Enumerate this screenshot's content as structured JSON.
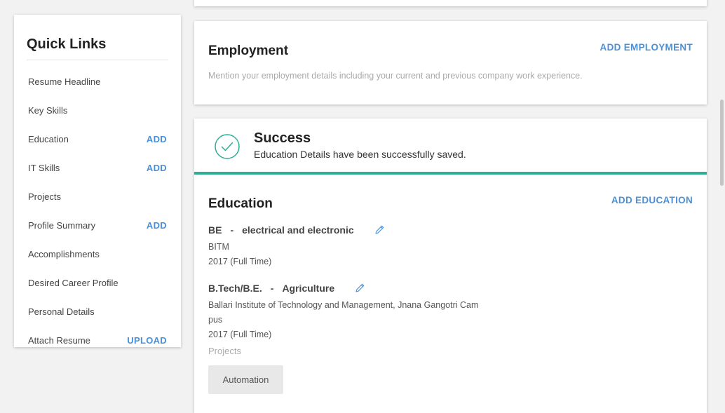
{
  "quick_links": {
    "title": "Quick Links",
    "items": [
      {
        "label": "Resume Headline",
        "action": ""
      },
      {
        "label": "Key Skills",
        "action": ""
      },
      {
        "label": "Education",
        "action": "ADD"
      },
      {
        "label": "IT Skills",
        "action": "ADD"
      },
      {
        "label": "Projects",
        "action": ""
      },
      {
        "label": "Profile Summary",
        "action": "ADD"
      },
      {
        "label": "Accomplishments",
        "action": ""
      },
      {
        "label": "Desired Career Profile",
        "action": ""
      },
      {
        "label": "Personal Details",
        "action": ""
      },
      {
        "label": "Attach Resume",
        "action": "UPLOAD"
      }
    ]
  },
  "employment": {
    "title": "Employment",
    "add_label": "ADD EMPLOYMENT",
    "description": "Mention your employment details including your current and previous company work experience."
  },
  "success": {
    "title": "Success",
    "message": "Education Details have been successfully saved."
  },
  "education": {
    "title": "Education",
    "add_label": "ADD EDUCATION",
    "entries": [
      {
        "degree": "BE",
        "separator": "-",
        "specialization": "electrical and electronic",
        "institute": "BITM",
        "year": "2017 (Full Time)"
      },
      {
        "degree": "B.Tech/B.E.",
        "separator": "-",
        "specialization": "Agriculture",
        "institute": "Ballari Institute of Technology and Management, Jnana Gangotri Campus",
        "year": "2017 (Full Time)"
      }
    ],
    "projects_label": "Projects",
    "project_chip": "Automation"
  },
  "colors": {
    "accent": "#4a90d9",
    "success": "#2fae96"
  }
}
